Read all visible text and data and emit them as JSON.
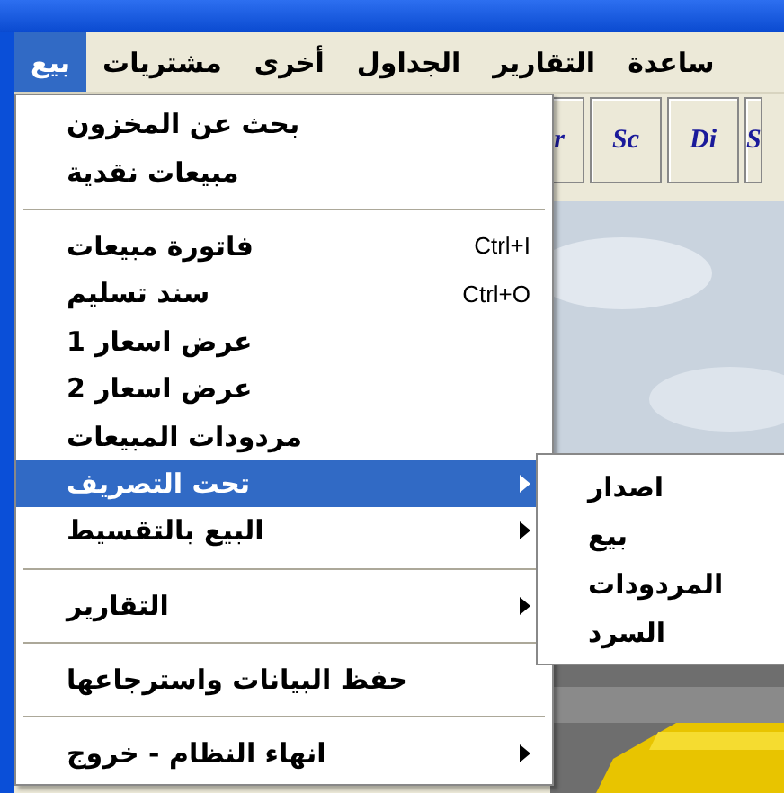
{
  "menu_bar": [
    {
      "label": "ساعدة",
      "selected": false
    },
    {
      "label": "التقارير",
      "selected": false
    },
    {
      "label": "الجداول",
      "selected": false
    },
    {
      "label": "أخرى",
      "selected": false
    },
    {
      "label": "مشتريات",
      "selected": false
    },
    {
      "label": "بيع",
      "selected": true
    }
  ],
  "toolbar": [
    "S",
    "Di",
    "Sc",
    "r"
  ],
  "dropdown": [
    {
      "kind": "item",
      "label": "بحث عن المخزون",
      "selected": false,
      "submenu": false
    },
    {
      "kind": "item",
      "label": "مبيعات نقدية",
      "selected": false,
      "submenu": false
    },
    {
      "kind": "separator"
    },
    {
      "kind": "item",
      "label": "فاتورة مبيعات",
      "shortcut": "Ctrl+I",
      "selected": false,
      "submenu": false
    },
    {
      "kind": "item",
      "label": "سند تسليم",
      "shortcut": "Ctrl+O",
      "selected": false,
      "submenu": false
    },
    {
      "kind": "item",
      "label": "عرض اسعار 1",
      "selected": false,
      "submenu": false
    },
    {
      "kind": "item",
      "label": "عرض اسعار 2",
      "selected": false,
      "submenu": false
    },
    {
      "kind": "item",
      "label": "مردودات المبيعات",
      "selected": false,
      "submenu": false
    },
    {
      "kind": "item",
      "label": "تحت التصريف",
      "selected": true,
      "submenu": true
    },
    {
      "kind": "item",
      "label": "البيع بالتقسيط",
      "selected": false,
      "submenu": true
    },
    {
      "kind": "separator"
    },
    {
      "kind": "item",
      "label": "التقارير",
      "selected": false,
      "submenu": true
    },
    {
      "kind": "separator"
    },
    {
      "kind": "item",
      "label": "حفظ البيانات واسترجاعها",
      "selected": false,
      "submenu": false
    },
    {
      "kind": "separator"
    },
    {
      "kind": "item",
      "label": "انهاء النظام - خروج",
      "selected": false,
      "submenu": true
    }
  ],
  "submenu": [
    "اصدار",
    "بيع",
    "المردودات",
    "السرد"
  ]
}
